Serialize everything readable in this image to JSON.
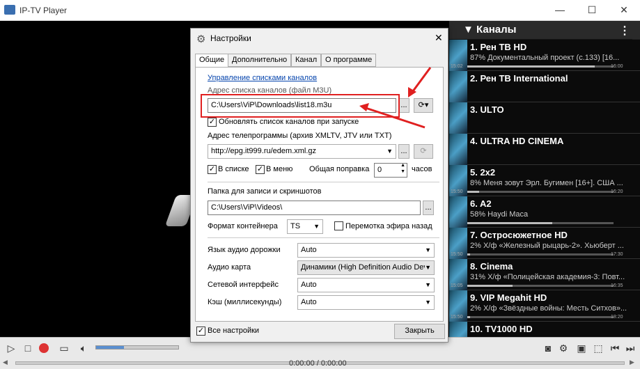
{
  "window": {
    "title": "IP-TV Player",
    "minimize": "—",
    "maximize": "☐",
    "close": "✕"
  },
  "sidebar": {
    "header": "▼ Каналы",
    "menu": "⋮",
    "channels": [
      {
        "name": "1. Рен ТВ HD",
        "program": "87% Документальный проект (с.133) [16...",
        "start": "15:02",
        "end": "16:00",
        "progress": 0.87
      },
      {
        "name": "2. Рен ТВ International",
        "program": "",
        "start": "",
        "end": "",
        "progress": 0
      },
      {
        "name": "3. ULTO",
        "program": "",
        "start": "",
        "end": "",
        "progress": 0
      },
      {
        "name": "4. ULTRA HD CINEMA",
        "program": "",
        "start": "",
        "end": "",
        "progress": 0
      },
      {
        "name": "5. 2x2",
        "program": "8% Меня зовут Эрл. Бугимен [16+]. США ...",
        "start": "15:50",
        "end": "16:20",
        "progress": 0.08
      },
      {
        "name": "6. A2",
        "program": "58% Haydi Maca",
        "start": "",
        "end": "",
        "progress": 0.58
      },
      {
        "name": "7. Остросюжетное HD",
        "program": "2% Х/ф «Железный рыцарь-2». Хьюберт ...",
        "start": "15:50",
        "end": "17:30",
        "progress": 0.02
      },
      {
        "name": "8. Cinema",
        "program": "31% Х/ф «Полицейская академия-3: Повт...",
        "start": "15:05",
        "end": "16:35",
        "progress": 0.31
      },
      {
        "name": "9. VIP Megahit HD",
        "program": "2% Х/ф «Звёздные войны: Месть Ситхов»...",
        "start": "15:50",
        "end": "18:20",
        "progress": 0.02
      },
      {
        "name": "10. TV1000 HD",
        "program": "",
        "start": "",
        "end": "",
        "progress": 0
      }
    ]
  },
  "dialog": {
    "title": "Настройки",
    "close": "✕",
    "tabs": [
      "Общие",
      "Дополнительно",
      "Канал",
      "О программе"
    ],
    "manage_link": "Управление списками каналов",
    "m3u_label": "Адрес списка каналов (файл M3U)",
    "m3u_value": "C:\\Users\\ViP\\Downloads\\list18.m3u",
    "browse": "...",
    "refresh_lists": "Обновлять список каналов при запуске",
    "epg_label": "Адрес телепрограммы (архив XMLTV, JTV или TXT)",
    "epg_value": "http://epg.it999.ru/edem.xml.gz",
    "in_list": "В списке",
    "in_menu": "В меню",
    "offset_label": "Общая поправка",
    "offset_value": "0",
    "hours": "часов",
    "rec_label": "Папка для записи и скриншотов",
    "rec_value": "C:\\Users\\ViP\\Videos\\",
    "container_label": "Формат контейнера",
    "container_value": "TS",
    "timeshift": "Перемотка эфира назад",
    "audio_track_label": "Язык аудио дорожки",
    "audio_track_value": "Auto",
    "audio_card_label": "Аудио карта",
    "audio_card_value": "Динамики (High Definition Audio Dev",
    "net_label": "Сетевой интерфейс",
    "net_value": "Auto",
    "cache_label": "Кэш (миллисекунды)",
    "cache_value": "Auto",
    "all_settings": "Все настройки",
    "close_button": "Закрыть"
  },
  "controls": {
    "time": "0:00:00 / 0:00:00"
  },
  "colors": {
    "highlight": "#e02020"
  }
}
